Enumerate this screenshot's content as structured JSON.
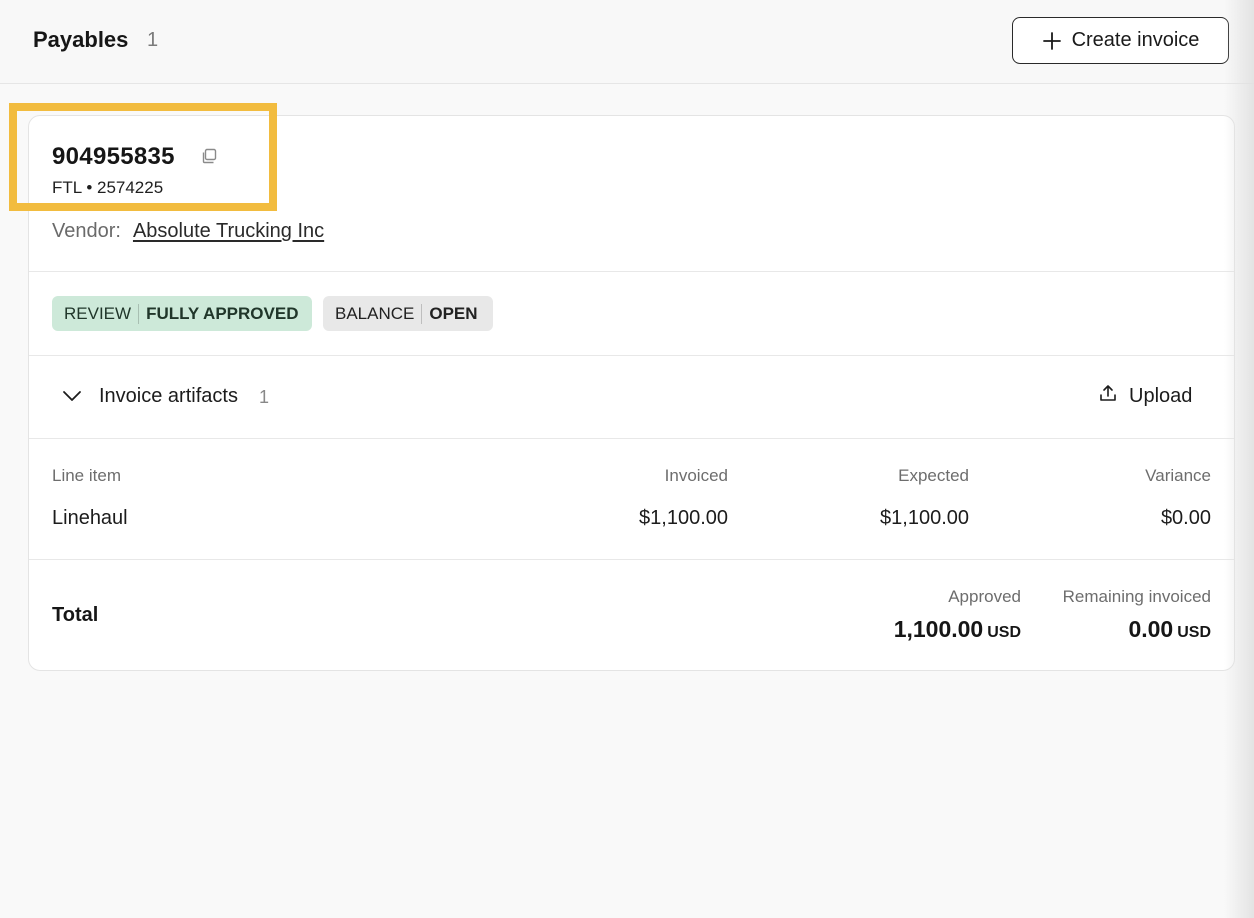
{
  "header": {
    "title": "Payables",
    "count": "1",
    "create_button_label": "Create invoice"
  },
  "invoice": {
    "number": "904955835",
    "sub_id": "FTL • 2574225",
    "vendor_label": "Vendor:",
    "vendor_name": "Absolute Trucking Inc"
  },
  "badges": {
    "review_label": "REVIEW",
    "review_value": "FULLY APPROVED",
    "balance_label": "BALANCE",
    "balance_value": "OPEN"
  },
  "artifacts": {
    "label": "Invoice artifacts",
    "count": "1",
    "upload_label": "Upload"
  },
  "line_items": {
    "columns": [
      "Line item",
      "Invoiced",
      "Expected",
      "Variance"
    ],
    "rows": [
      {
        "item": "Linehaul",
        "invoiced": "$1,100.00",
        "expected": "$1,100.00",
        "variance": "$0.00"
      }
    ]
  },
  "totals": {
    "label": "Total",
    "approved_label": "Approved",
    "approved_value": "1,100.00",
    "approved_currency": "USD",
    "remaining_label": "Remaining invoiced",
    "remaining_value": "0.00",
    "remaining_currency": "USD"
  },
  "colors": {
    "highlight": "#f2bc3f",
    "review_badge_bg": "#cde9d9",
    "balance_badge_bg": "#e8e8e8"
  },
  "icons": {
    "create": "plus-icon",
    "copy": "copy-icon",
    "collapse": "chevron-down-icon",
    "upload": "upload-icon"
  }
}
